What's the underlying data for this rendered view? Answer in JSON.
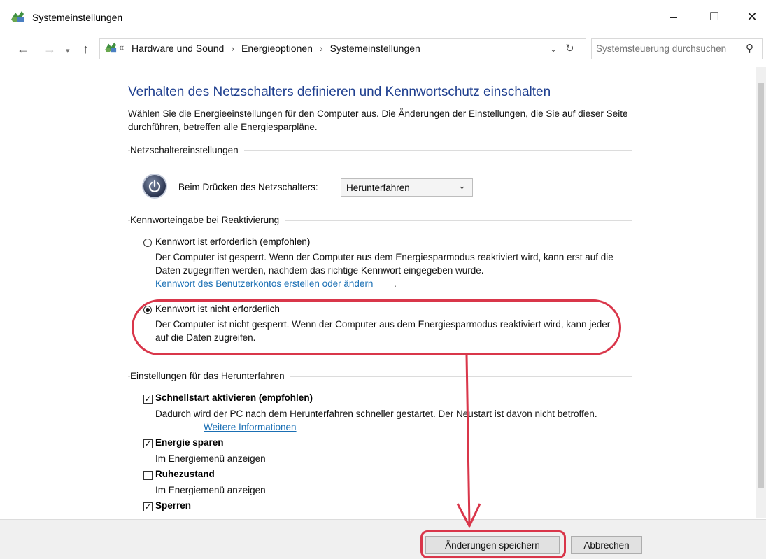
{
  "window": {
    "title": "Systemeinstellungen",
    "controls": {
      "minimize": "–",
      "maximize": "☐",
      "close": "✕"
    }
  },
  "address": {
    "breadcrumb_prefix": "«",
    "crumbs": [
      "Hardware und Sound",
      "Energieoptionen",
      "Systemeinstellungen"
    ],
    "separator": "›",
    "search_placeholder": "Systemsteuerung durchsuchen"
  },
  "page": {
    "heading": "Verhalten des Netzschalters definieren und Kennwortschutz einschalten",
    "intro": "Wählen Sie die Energieeinstellungen für den Computer aus. Die Änderungen der Einstellungen, die Sie auf dieser Seite durchführen, betreffen alle Energiesparpläne."
  },
  "power_button": {
    "section_title": "Netzschaltereinstellungen",
    "label": "Beim Drücken des Netzschalters:",
    "selected": "Herunterfahren"
  },
  "password": {
    "section_title": "Kennworteingabe bei Reaktivierung",
    "option_required": {
      "label": "Kennwort ist erforderlich (empfohlen)",
      "description": "Der Computer ist gesperrt. Wenn der Computer aus dem Energiesparmodus reaktiviert wird, kann erst auf die Daten zugegriffen werden, nachdem das richtige Kennwort eingegeben wurde.",
      "link": "Kennwort des Benutzerkontos erstellen oder ändern"
    },
    "option_not_required": {
      "label": "Kennwort ist nicht erforderlich",
      "description": "Der Computer ist nicht gesperrt. Wenn der Computer aus dem Energiesparmodus reaktiviert wird, kann jeder auf die Daten zugreifen."
    },
    "selected": "not_required"
  },
  "shutdown": {
    "section_title": "Einstellungen für das Herunterfahren",
    "fast_startup": {
      "label": "Schnellstart aktivieren (empfohlen)",
      "description": "Dadurch wird der PC nach dem Herunterfahren schneller gestartet. Der Neustart ist davon nicht betroffen.",
      "link": "Weitere Informationen",
      "checked": true
    },
    "sleep": {
      "label": "Energie sparen",
      "description": "Im Energiemenü anzeigen",
      "checked": true
    },
    "hibernate": {
      "label": "Ruhezustand",
      "description": "Im Energiemenü anzeigen",
      "checked": false
    },
    "lock": {
      "label": "Sperren",
      "checked": true
    }
  },
  "buttons": {
    "save": "Änderungen speichern",
    "cancel": "Abbrechen"
  },
  "colors": {
    "annotation": "#d9364a",
    "heading": "#1f3f8f",
    "link": "#1a6fb4"
  }
}
